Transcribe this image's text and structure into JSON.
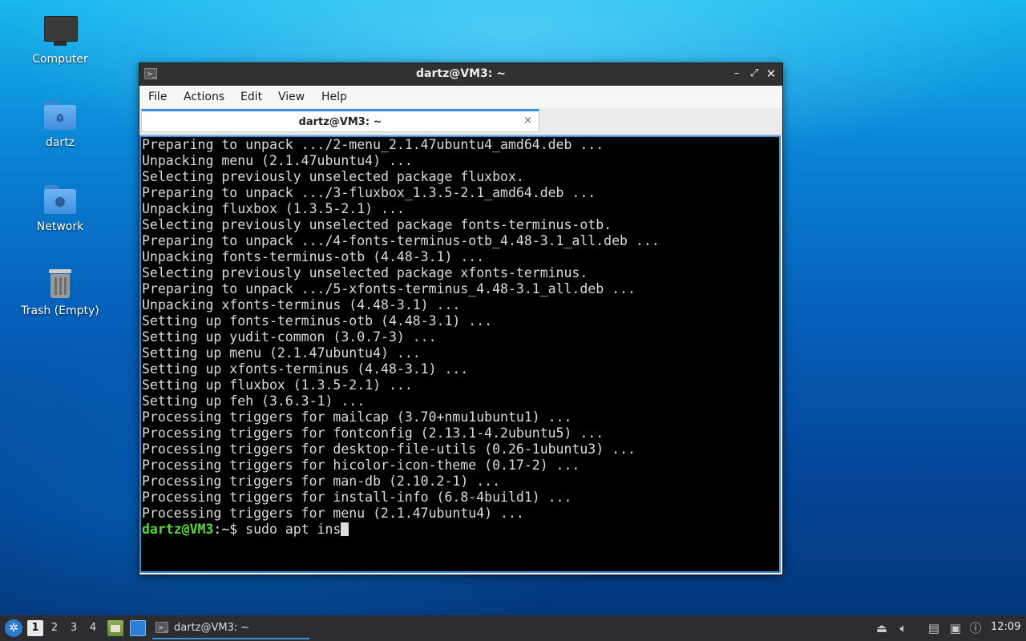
{
  "desktop": {
    "icons": [
      {
        "label": "Computer",
        "icon": "computer-icon"
      },
      {
        "label": "dartz",
        "icon": "home-folder-icon"
      },
      {
        "label": "Network",
        "icon": "network-folder-icon"
      },
      {
        "label": "Trash (Empty)",
        "icon": "trash-icon"
      }
    ]
  },
  "window": {
    "title": "dartz@VM3: ~",
    "controls": {
      "minimize": "–",
      "maximize": "⤢",
      "close": "✕"
    },
    "menu": [
      "File",
      "Actions",
      "Edit",
      "View",
      "Help"
    ],
    "tab": {
      "label": "dartz@VM3: ~",
      "close": "×"
    }
  },
  "terminal": {
    "lines": [
      "Preparing to unpack .../2-menu_2.1.47ubuntu4_amd64.deb ...",
      "Unpacking menu (2.1.47ubuntu4) ...",
      "Selecting previously unselected package fluxbox.",
      "Preparing to unpack .../3-fluxbox_1.3.5-2.1_amd64.deb ...",
      "Unpacking fluxbox (1.3.5-2.1) ...",
      "Selecting previously unselected package fonts-terminus-otb.",
      "Preparing to unpack .../4-fonts-terminus-otb_4.48-3.1_all.deb ...",
      "Unpacking fonts-terminus-otb (4.48-3.1) ...",
      "Selecting previously unselected package xfonts-terminus.",
      "Preparing to unpack .../5-xfonts-terminus_4.48-3.1_all.deb ...",
      "Unpacking xfonts-terminus (4.48-3.1) ...",
      "Setting up fonts-terminus-otb (4.48-3.1) ...",
      "Setting up yudit-common (3.0.7-3) ...",
      "Setting up menu (2.1.47ubuntu4) ...",
      "Setting up xfonts-terminus (4.48-3.1) ...",
      "Setting up fluxbox (1.3.5-2.1) ...",
      "Setting up feh (3.6.3-1) ...",
      "Processing triggers for mailcap (3.70+nmu1ubuntu1) ...",
      "Processing triggers for fontconfig (2.13.1-4.2ubuntu5) ...",
      "Processing triggers for desktop-file-utils (0.26-1ubuntu3) ...",
      "Processing triggers for hicolor-icon-theme (0.17-2) ...",
      "Processing triggers for man-db (2.10.2-1) ...",
      "Processing triggers for install-info (6.8-4build1) ...",
      "Processing triggers for menu (2.1.47ubuntu4) ..."
    ],
    "prompt": {
      "user": "dartz@VM3",
      "path": ":~",
      "symbol": "$ ",
      "input": "sudo apt ins"
    }
  },
  "taskbar": {
    "workspaces": [
      "1",
      "2",
      "3",
      "4"
    ],
    "active_workspace": "1",
    "task": {
      "label": "dartz@VM3: ~",
      "icon": "terminal-icon"
    },
    "tray": [
      "eject-icon",
      "volume-icon",
      "clipboard-icon",
      "network-icon",
      "notification-icon"
    ],
    "clock": "12:09"
  },
  "colors": {
    "accent": "#3d8fe0",
    "prompt_user": "#5bd63c",
    "terminal_bg": "#000000"
  }
}
